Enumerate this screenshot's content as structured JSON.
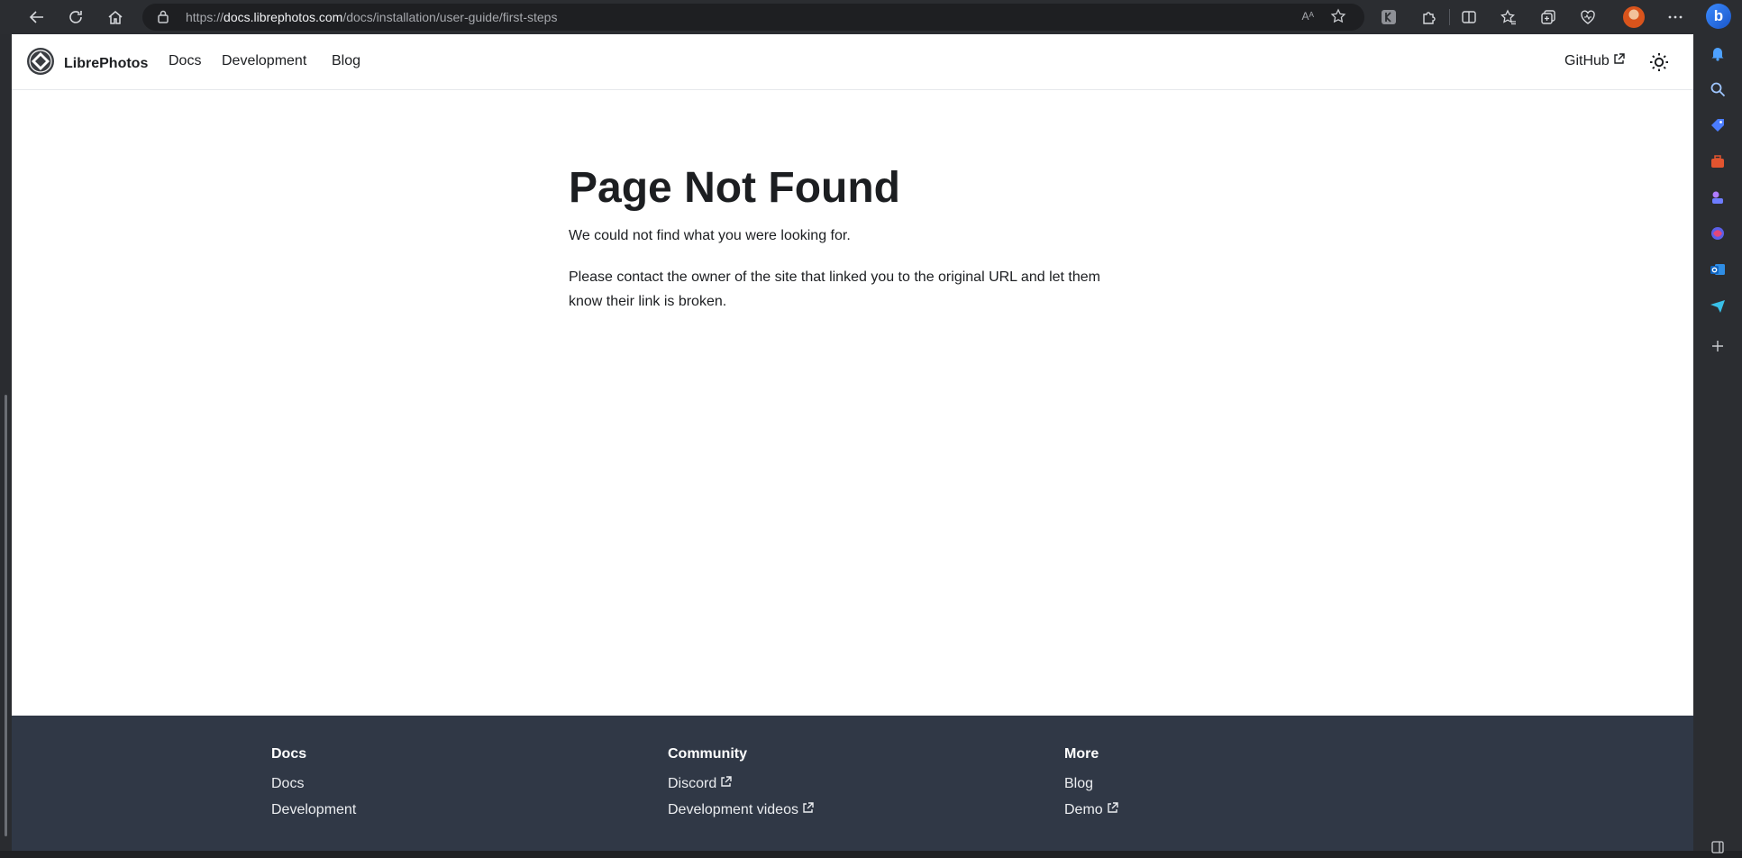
{
  "browser": {
    "url_prefix": "https://",
    "url_host": "docs.librephotos.com",
    "url_path": "/docs/installation/user-guide/first-steps",
    "read_aloud_label": "Aᴬ"
  },
  "navbar": {
    "brand": "LibrePhotos",
    "links": [
      "Docs",
      "Development",
      "Blog"
    ],
    "github_label": "GitHub"
  },
  "main": {
    "title": "Page Not Found",
    "paragraph1": "We could not find what you were looking for.",
    "paragraph2_line1": "Please contact the owner of the site that linked you to the original URL and let them",
    "paragraph2_line2": "know their link is broken."
  },
  "footer": {
    "columns": [
      {
        "title": "Docs",
        "links": [
          "Docs",
          "Development"
        ]
      },
      {
        "title": "Community",
        "links": [
          "Discord",
          "Development videos"
        ]
      },
      {
        "title": "More",
        "links": [
          "Blog",
          "Demo"
        ]
      }
    ]
  },
  "colors": {
    "footer_bg": "#303846",
    "chrome_bg": "#2b2d31",
    "text": "#1c1e21"
  }
}
